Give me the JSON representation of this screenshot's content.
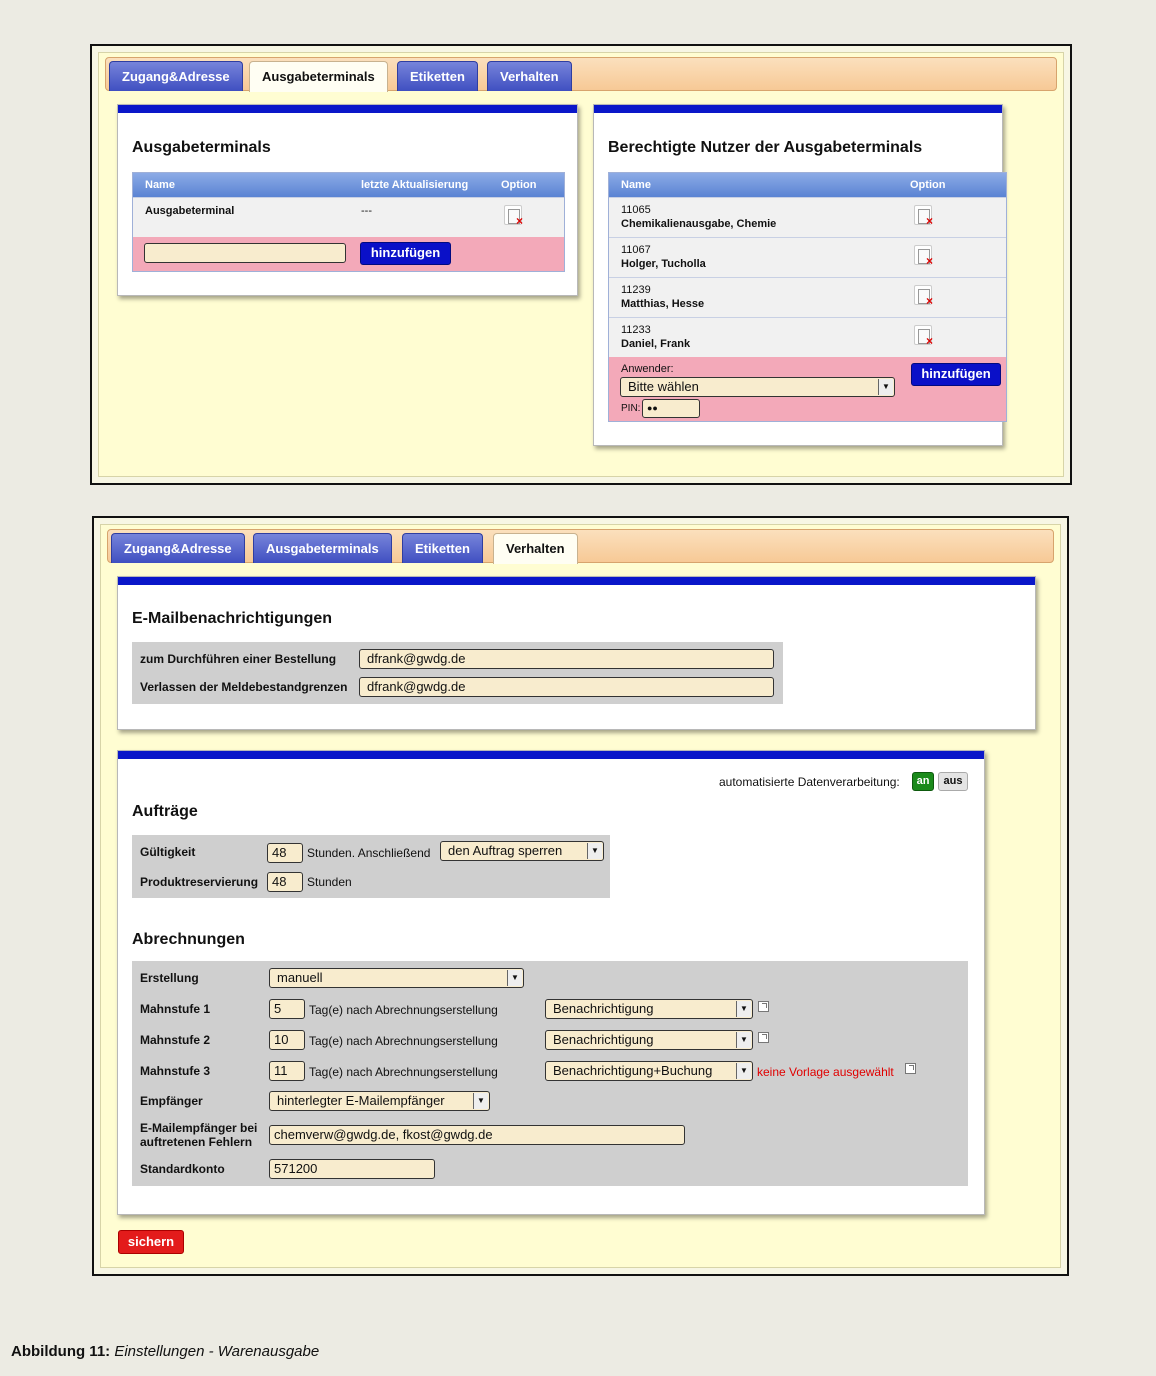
{
  "screenshot1": {
    "tabs": [
      "Zugang&Adresse",
      "Ausgabeterminals",
      "Etiketten",
      "Verhalten"
    ],
    "terminals": {
      "title": "Ausgabeterminals",
      "headers": [
        "Name",
        "letzte Aktualisierung",
        "Option"
      ],
      "rows": [
        {
          "name": "Ausgabeterminal",
          "updated": "---"
        }
      ],
      "add_value": "",
      "add_button": "hinzufügen"
    },
    "users": {
      "title": "Berechtigte Nutzer der Ausgabeterminals",
      "headers": [
        "Name",
        "Option"
      ],
      "rows": [
        {
          "id": "11065",
          "name": "Chemikalienausgabe, Chemie"
        },
        {
          "id": "11067",
          "name": "Holger, Tucholla"
        },
        {
          "id": "11239",
          "name": "Matthias, Hesse"
        },
        {
          "id": "11233",
          "name": "Daniel, Frank"
        }
      ],
      "user_label": "Anwender:",
      "user_select": "Bitte wählen",
      "pin_label": "PIN:",
      "pin_value": "●●",
      "add_button": "hinzufügen"
    }
  },
  "screenshot2": {
    "tabs": [
      "Zugang&Adresse",
      "Ausgabeterminals",
      "Etiketten",
      "Verhalten"
    ],
    "email": {
      "title": "E-Mailbenachrichtigungen",
      "rows": [
        {
          "label": "zum Durchführen einer Bestellung",
          "value": "dfrank@gwdg.de"
        },
        {
          "label": "Verlassen der Meldebestandgrenzen",
          "value": "dfrank@gwdg.de"
        }
      ]
    },
    "auto": {
      "label": "automatisierte Datenverarbeitung:",
      "on": "an",
      "off": "aus"
    },
    "orders": {
      "title": "Aufträge",
      "validity_label": "Gültigkeit",
      "validity_value": "48",
      "validity_text": "Stunden. Anschließend",
      "validity_action": "den Auftrag sperren",
      "reservation_label": "Produktreservierung",
      "reservation_value": "48",
      "reservation_unit": "Stunden"
    },
    "billing": {
      "title": "Abrechnungen",
      "creation_label": "Erstellung",
      "creation_value": "manuell",
      "levels": [
        {
          "label": "Mahnstufe 1",
          "days": "5",
          "text": "Tag(e) nach Abrechnungserstellung",
          "action": "Benachrichtigung",
          "note": ""
        },
        {
          "label": "Mahnstufe 2",
          "days": "10",
          "text": "Tag(e) nach Abrechnungserstellung",
          "action": "Benachrichtigung",
          "note": ""
        },
        {
          "label": "Mahnstufe 3",
          "days": "11",
          "text": "Tag(e) nach Abrechnungserstellung",
          "action": "Benachrichtigung+Buchung",
          "note": "keine Vorlage ausgewählt"
        }
      ],
      "recipient_label": "Empfänger",
      "recipient_value": "hinterlegter E-Mailempfänger",
      "error_label_1": "E-Mailempfänger bei",
      "error_label_2": "auftretenen Fehlern",
      "error_value": "chemverw@gwdg.de, fkost@gwdg.de",
      "account_label": "Standardkonto",
      "account_value": "571200"
    },
    "save": "sichern"
  },
  "caption": {
    "prefix": "Abbildung 11:",
    "text": "Einstellungen - Warenausgabe"
  },
  "colors": {
    "tab": "#3f4fc1",
    "panel_bar": "#0a17c9",
    "button": "#0a10c8",
    "add_row": "#f3a9b9",
    "on": "#1a8a1a",
    "save": "#e31b1b",
    "note": "#e00000"
  }
}
